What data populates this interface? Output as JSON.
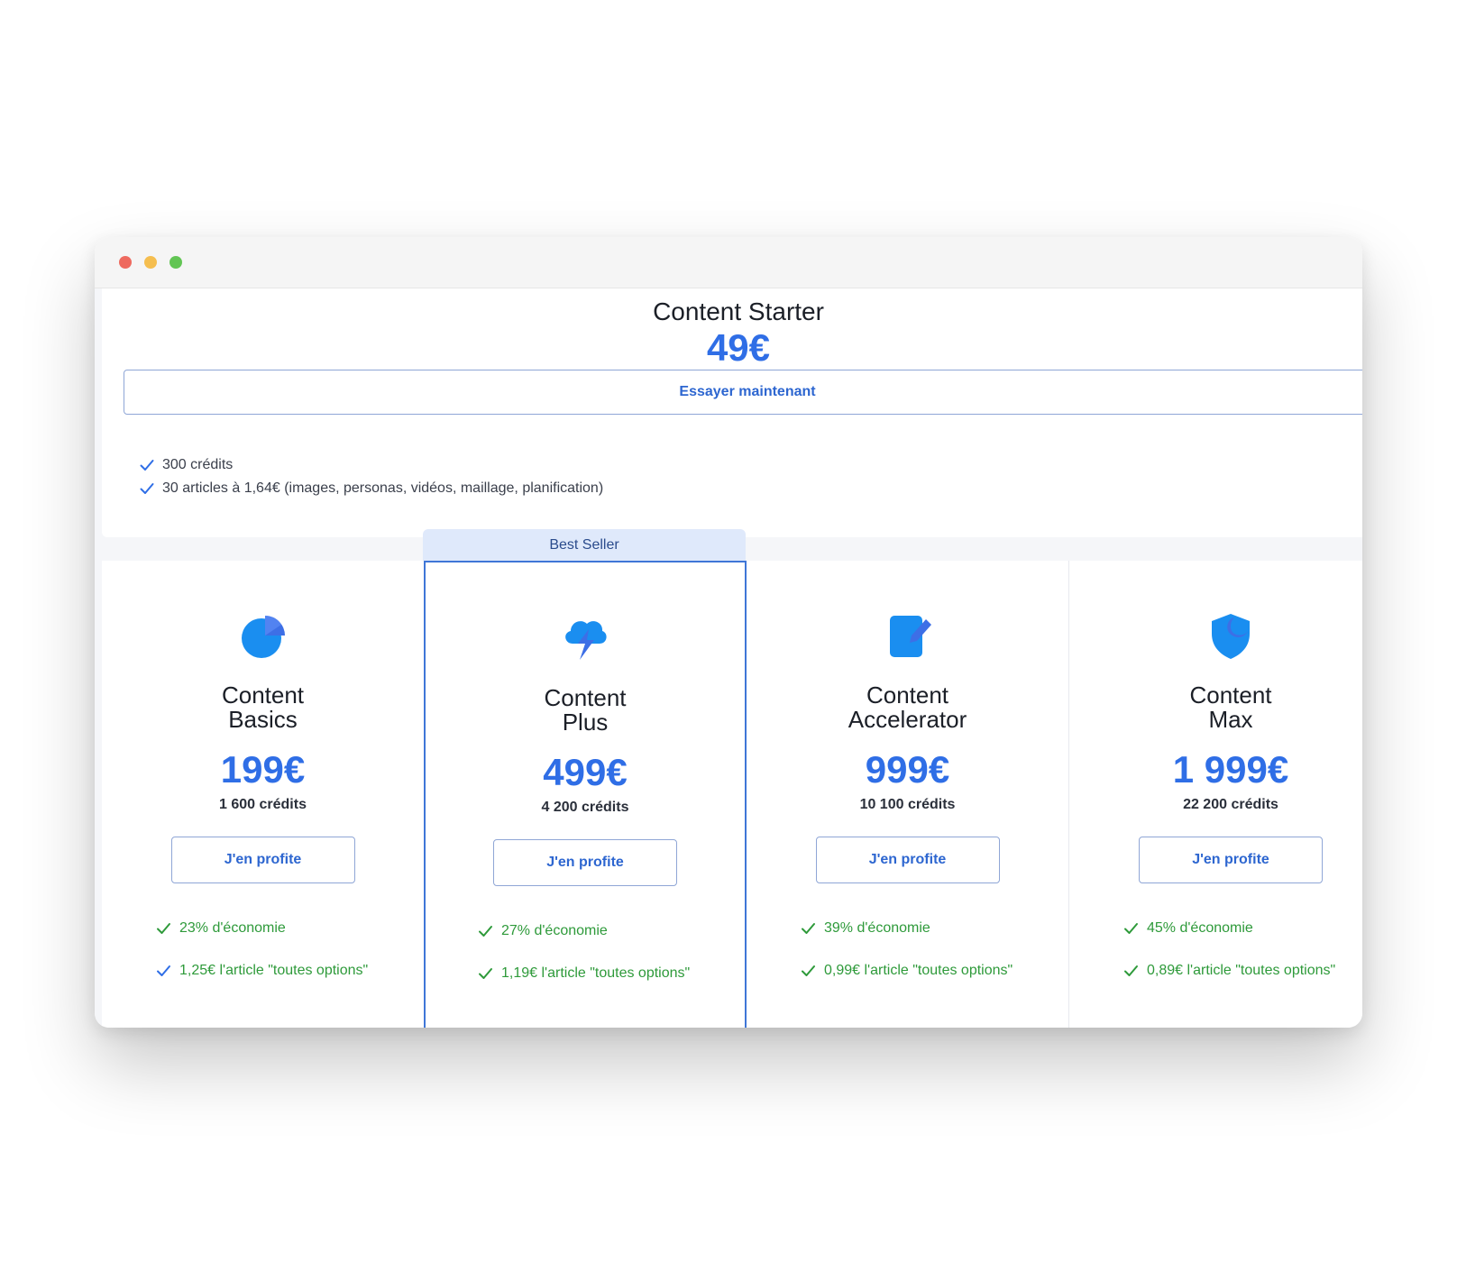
{
  "starter": {
    "title": "Content Starter",
    "price": "49€",
    "button": "Essayer maintenant",
    "features": [
      "300 crédits",
      "30 articles à 1,64€ (images, personas, vidéos, maillage, planification)"
    ]
  },
  "best_seller_label": "Best Seller",
  "plans": [
    {
      "name_line1": "Content",
      "name_line2": "Basics",
      "price": "199€",
      "credits": "1 600 crédits",
      "button": "J'en profite",
      "features": [
        "23% d'économie",
        "1,25€ l'article \"toutes options\""
      ],
      "icon": "pie-chart-icon"
    },
    {
      "name_line1": "Content",
      "name_line2": "Plus",
      "price": "499€",
      "credits": "4 200 crédits",
      "button": "J'en profite",
      "features": [
        "27% d'économie",
        "1,19€ l'article \"toutes options\""
      ],
      "icon": "cloud-lightning-icon"
    },
    {
      "name_line1": "Content",
      "name_line2": "Accelerator",
      "price": "999€",
      "credits": "10 100 crédits",
      "button": "J'en profite",
      "features": [
        "39% d'économie",
        "0,99€ l'article \"toutes options\""
      ],
      "icon": "document-pen-icon"
    },
    {
      "name_line1": "Content",
      "name_line2": "Max",
      "price": "1 999€",
      "credits": "22 200 crédits",
      "button": "J'en profite",
      "features": [
        "45% d'économie",
        "0,89€ l'article \"toutes options\""
      ],
      "icon": "shield-moon-icon"
    }
  ],
  "colors": {
    "accent": "#2f6ee6",
    "button_text": "#2d66d0",
    "feature_green": "#2e9a3a",
    "best_seller_bg": "#dfe9fb",
    "highlight_border": "#3f76d7"
  }
}
